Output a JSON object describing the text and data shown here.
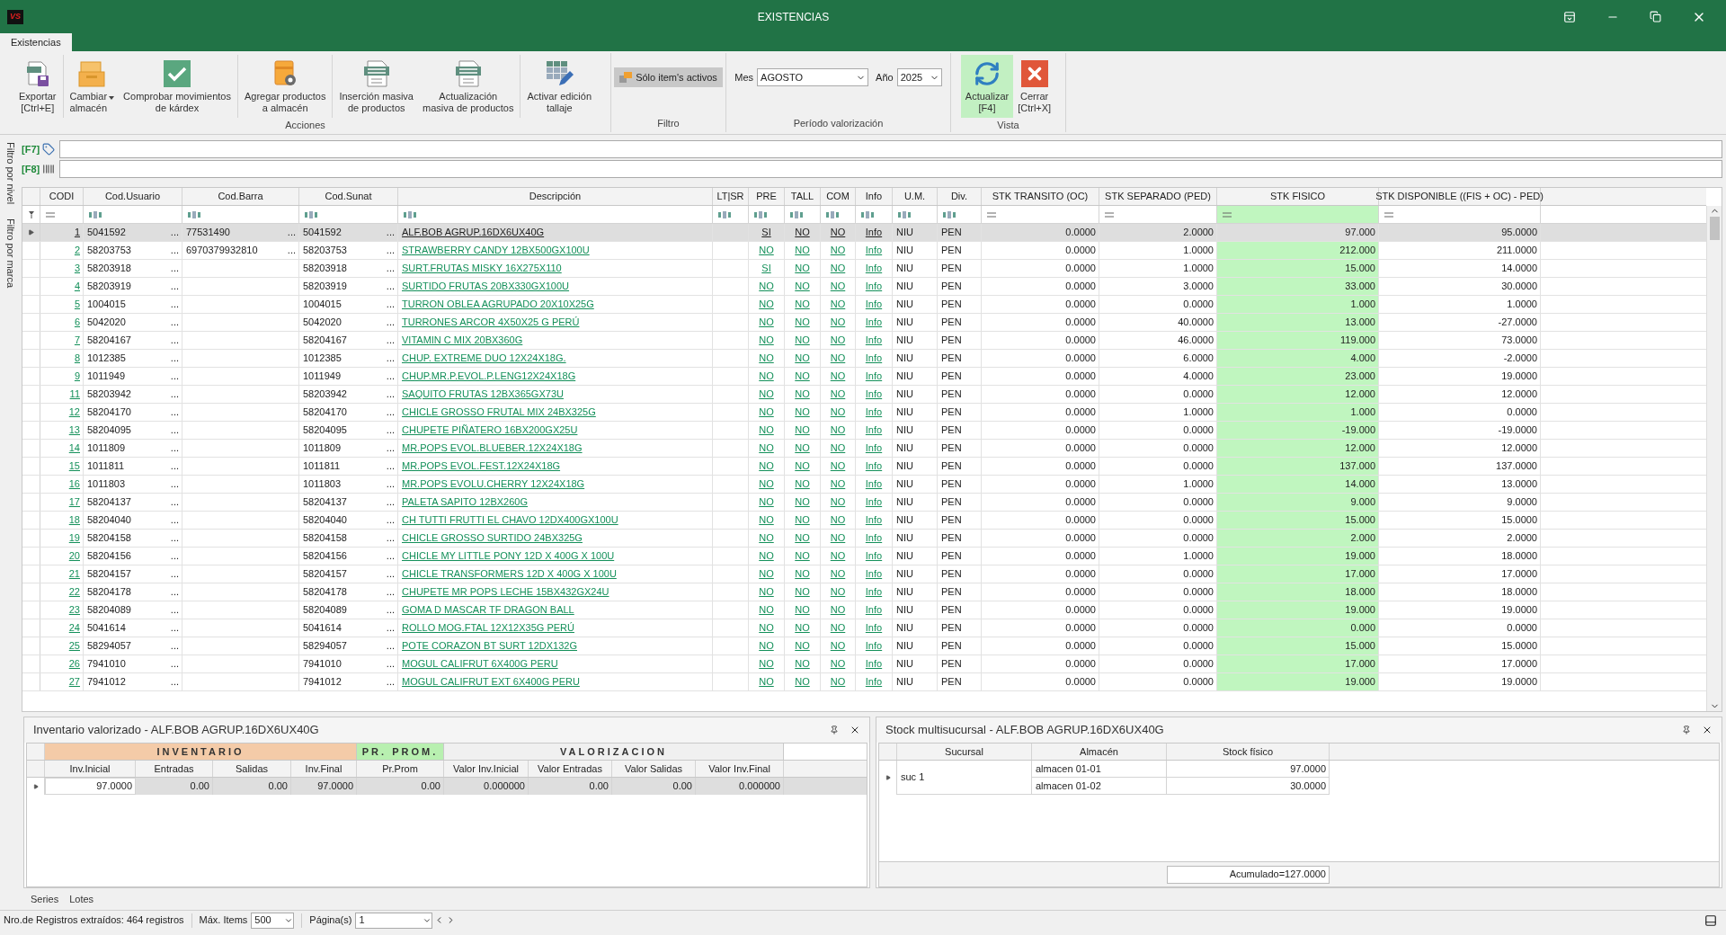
{
  "window": {
    "logo": "VS",
    "title": "EXISTENCIAS"
  },
  "ribbon_tabs": [
    {
      "label": "Existencias",
      "selected": true
    }
  ],
  "ribbon": {
    "acciones": {
      "label": "Acciones",
      "sections": [
        [
          {
            "kind": "export",
            "label": "Exportar\n[Ctrl+E]"
          }
        ],
        [
          {
            "kind": "warehouse",
            "label": "Cambiar\nalmacén",
            "dropdown": true
          },
          {
            "kind": "check",
            "label": "Comprobar movimientos\nde kárdex"
          }
        ],
        [
          {
            "kind": "box-gear",
            "label": "Agregar productos\na almacén"
          }
        ],
        [
          {
            "kind": "sheet",
            "label": "Inserción masiva\nde productos"
          },
          {
            "kind": "sheet",
            "label": "Actualización\nmasiva de productos"
          }
        ],
        [
          {
            "kind": "grid-edit",
            "label": "Activar edición\ntallaje"
          }
        ]
      ]
    },
    "filtro": {
      "label": "Filtro",
      "toggle": {
        "label": "Sólo item's activos",
        "pressed": true
      }
    },
    "periodo": {
      "label": "Período valorización",
      "fields": [
        {
          "label": "Mes",
          "value": "AGOSTO"
        },
        {
          "label": "Año",
          "value": "2025"
        }
      ]
    },
    "vista": {
      "label": "Vista",
      "buttons": [
        {
          "kind": "refresh",
          "label": "Actualizar\n[F4]",
          "highlighted": true
        },
        {
          "kind": "close",
          "label": "Cerrar\n[Ctrl+X]",
          "highlighted": false
        }
      ]
    }
  },
  "side_labels": [
    "Filtro por nivel",
    "Filtro por marca"
  ],
  "filters": [
    {
      "key": "[F7]",
      "kind": "tag"
    },
    {
      "key": "[F8]",
      "kind": "barcode"
    }
  ],
  "grid": {
    "columns": [
      {
        "label": "CODI",
        "kind": "link",
        "highlighted": false
      },
      {
        "label": "Cod.Usuario",
        "kind": "code",
        "highlighted": false
      },
      {
        "label": "Cod.Barra",
        "kind": "code",
        "highlighted": false
      },
      {
        "label": "Cod.Sunat",
        "kind": "code",
        "highlighted": false
      },
      {
        "label": "Descripción",
        "kind": "link",
        "highlighted": false
      },
      {
        "label": "LT|SR",
        "kind": "text",
        "highlighted": false
      },
      {
        "label": "PRE",
        "kind": "link",
        "highlighted": false
      },
      {
        "label": "TALL",
        "kind": "link",
        "highlighted": false
      },
      {
        "label": "COM",
        "kind": "link",
        "highlighted": false
      },
      {
        "label": "Info",
        "kind": "link",
        "highlighted": false
      },
      {
        "label": "U.M.",
        "kind": "text",
        "highlighted": false
      },
      {
        "label": "Div.",
        "kind": "text",
        "highlighted": false
      },
      {
        "label": "STK TRANSITO (OC)",
        "kind": "number",
        "highlighted": false
      },
      {
        "label": "STK SEPARADO (PED)",
        "kind": "number",
        "highlighted": false
      },
      {
        "label": "STK FISICO",
        "kind": "number",
        "highlighted": true
      },
      {
        "label": "STK DISPONIBLE ((FIS + OC) - PED)",
        "kind": "number",
        "highlighted": false
      }
    ],
    "more": "...",
    "rows": [
      {
        "selected": true,
        "codi": "1",
        "usuario": "5041592",
        "barra": "77531490",
        "sunat": "5041592",
        "descripcion": "ALF.BOB AGRUP.16DX6UX40G",
        "pre": "SI",
        "tall": "NO",
        "com": "NO",
        "info": "Info",
        "um": "NIU",
        "div": "PEN",
        "transito": "0.0000",
        "separado": "2.0000",
        "fisico": "97.000",
        "disponible": "95.0000"
      },
      {
        "selected": false,
        "codi": "2",
        "usuario": "58203753",
        "barra": "6970379932810",
        "sunat": "58203753",
        "descripcion": "STRAWBERRY CANDY 12BX500GX100U",
        "pre": "NO",
        "tall": "NO",
        "com": "NO",
        "info": "Info",
        "um": "NIU",
        "div": "PEN",
        "transito": "0.0000",
        "separado": "1.0000",
        "fisico": "212.000",
        "disponible": "211.0000"
      },
      {
        "selected": false,
        "codi": "3",
        "usuario": "58203918",
        "sunat": "58203918",
        "descripcion": "SURT.FRUTAS MISKY 16X275X110",
        "pre": "SI",
        "tall": "NO",
        "com": "NO",
        "info": "Info",
        "um": "NIU",
        "div": "PEN",
        "transito": "0.0000",
        "separado": "1.0000",
        "fisico": "15.000",
        "disponible": "14.0000"
      },
      {
        "selected": false,
        "codi": "4",
        "usuario": "58203919",
        "sunat": "58203919",
        "descripcion": "SURTIDO FRUTAS 20BX330GX100U",
        "pre": "NO",
        "tall": "NO",
        "com": "NO",
        "info": "Info",
        "um": "NIU",
        "div": "PEN",
        "transito": "0.0000",
        "separado": "3.0000",
        "fisico": "33.000",
        "disponible": "30.0000"
      },
      {
        "selected": false,
        "codi": "5",
        "usuario": "1004015",
        "sunat": "1004015",
        "descripcion": "TURRON OBLEA AGRUPADO 20X10X25G",
        "pre": "NO",
        "tall": "NO",
        "com": "NO",
        "info": "Info",
        "um": "NIU",
        "div": "PEN",
        "transito": "0.0000",
        "separado": "0.0000",
        "fisico": "1.000",
        "disponible": "1.0000"
      },
      {
        "selected": false,
        "codi": "6",
        "usuario": "5042020",
        "sunat": "5042020",
        "descripcion": "TURRONES ARCOR 4X50X25 G PERÚ",
        "pre": "NO",
        "tall": "NO",
        "com": "NO",
        "info": "Info",
        "um": "NIU",
        "div": "PEN",
        "transito": "0.0000",
        "separado": "40.0000",
        "fisico": "13.000",
        "disponible": "-27.0000"
      },
      {
        "selected": false,
        "codi": "7",
        "usuario": "58204167",
        "sunat": "58204167",
        "descripcion": "VITAMIN C MIX 20BX360G",
        "pre": "NO",
        "tall": "NO",
        "com": "NO",
        "info": "Info",
        "um": "NIU",
        "div": "PEN",
        "transito": "0.0000",
        "separado": "46.0000",
        "fisico": "119.000",
        "disponible": "73.0000"
      },
      {
        "selected": false,
        "codi": "8",
        "usuario": "1012385",
        "sunat": "1012385",
        "descripcion": "CHUP. EXTREME DUO 12X24X18G.",
        "pre": "NO",
        "tall": "NO",
        "com": "NO",
        "info": "Info",
        "um": "NIU",
        "div": "PEN",
        "transito": "0.0000",
        "separado": "6.0000",
        "fisico": "4.000",
        "disponible": "-2.0000"
      },
      {
        "selected": false,
        "codi": "9",
        "usuario": "1011949",
        "sunat": "1011949",
        "descripcion": "CHUP.MR.P.EVOL.P.LENG12X24X18G",
        "pre": "NO",
        "tall": "NO",
        "com": "NO",
        "info": "Info",
        "um": "NIU",
        "div": "PEN",
        "transito": "0.0000",
        "separado": "4.0000",
        "fisico": "23.000",
        "disponible": "19.0000"
      },
      {
        "selected": false,
        "codi": "11",
        "usuario": "58203942",
        "sunat": "58203942",
        "descripcion": "SAQUITO FRUTAS 12BX365GX73U",
        "pre": "NO",
        "tall": "NO",
        "com": "NO",
        "info": "Info",
        "um": "NIU",
        "div": "PEN",
        "transito": "0.0000",
        "separado": "0.0000",
        "fisico": "12.000",
        "disponible": "12.0000"
      },
      {
        "selected": false,
        "codi": "12",
        "usuario": "58204170",
        "sunat": "58204170",
        "descripcion": "CHICLE GROSSO FRUTAL MIX 24BX325G",
        "pre": "NO",
        "tall": "NO",
        "com": "NO",
        "info": "Info",
        "um": "NIU",
        "div": "PEN",
        "transito": "0.0000",
        "separado": "1.0000",
        "fisico": "1.000",
        "disponible": "0.0000"
      },
      {
        "selected": false,
        "codi": "13",
        "usuario": "58204095",
        "sunat": "58204095",
        "descripcion": "CHUPETE PIÑATERO 16BX200GX25U",
        "pre": "NO",
        "tall": "NO",
        "com": "NO",
        "info": "Info",
        "um": "NIU",
        "div": "PEN",
        "transito": "0.0000",
        "separado": "0.0000",
        "fisico": "-19.000",
        "disponible": "-19.0000"
      },
      {
        "selected": false,
        "codi": "14",
        "usuario": "1011809",
        "sunat": "1011809",
        "descripcion": "MR.POPS EVOL.BLUEBER.12X24X18G",
        "pre": "NO",
        "tall": "NO",
        "com": "NO",
        "info": "Info",
        "um": "NIU",
        "div": "PEN",
        "transito": "0.0000",
        "separado": "0.0000",
        "fisico": "12.000",
        "disponible": "12.0000"
      },
      {
        "selected": false,
        "codi": "15",
        "usuario": "1011811",
        "sunat": "1011811",
        "descripcion": "MR.POPS EVOL.FEST.12X24X18G",
        "pre": "NO",
        "tall": "NO",
        "com": "NO",
        "info": "Info",
        "um": "NIU",
        "div": "PEN",
        "transito": "0.0000",
        "separado": "0.0000",
        "fisico": "137.000",
        "disponible": "137.0000"
      },
      {
        "selected": false,
        "codi": "16",
        "usuario": "1011803",
        "sunat": "1011803",
        "descripcion": "MR.POPS EVOLU.CHERRY 12X24X18G",
        "pre": "NO",
        "tall": "NO",
        "com": "NO",
        "info": "Info",
        "um": "NIU",
        "div": "PEN",
        "transito": "0.0000",
        "separado": "1.0000",
        "fisico": "14.000",
        "disponible": "13.0000"
      },
      {
        "selected": false,
        "codi": "17",
        "usuario": "58204137",
        "sunat": "58204137",
        "descripcion": "PALETA SAPITO 12BX260G",
        "pre": "NO",
        "tall": "NO",
        "com": "NO",
        "info": "Info",
        "um": "NIU",
        "div": "PEN",
        "transito": "0.0000",
        "separado": "0.0000",
        "fisico": "9.000",
        "disponible": "9.0000"
      },
      {
        "selected": false,
        "codi": "18",
        "usuario": "58204040",
        "sunat": "58204040",
        "descripcion": "CH TUTTI FRUTTI EL CHAVO 12DX400GX100U",
        "pre": "NO",
        "tall": "NO",
        "com": "NO",
        "info": "Info",
        "um": "NIU",
        "div": "PEN",
        "transito": "0.0000",
        "separado": "0.0000",
        "fisico": "15.000",
        "disponible": "15.0000"
      },
      {
        "selected": false,
        "codi": "19",
        "usuario": "58204158",
        "sunat": "58204158",
        "descripcion": "CHICLE GROSSO SURTIDO 24BX325G",
        "pre": "NO",
        "tall": "NO",
        "com": "NO",
        "info": "Info",
        "um": "NIU",
        "div": "PEN",
        "transito": "0.0000",
        "separado": "0.0000",
        "fisico": "2.000",
        "disponible": "2.0000"
      },
      {
        "selected": false,
        "codi": "20",
        "usuario": "58204156",
        "sunat": "58204156",
        "descripcion": "CHICLE MY LITTLE PONY 12D X 400G X 100U",
        "pre": "NO",
        "tall": "NO",
        "com": "NO",
        "info": "Info",
        "um": "NIU",
        "div": "PEN",
        "transito": "0.0000",
        "separado": "1.0000",
        "fisico": "19.000",
        "disponible": "18.0000"
      },
      {
        "selected": false,
        "codi": "21",
        "usuario": "58204157",
        "sunat": "58204157",
        "descripcion": "CHICLE TRANSFORMERS 12D X 400G X 100U",
        "pre": "NO",
        "tall": "NO",
        "com": "NO",
        "info": "Info",
        "um": "NIU",
        "div": "PEN",
        "transito": "0.0000",
        "separado": "0.0000",
        "fisico": "17.000",
        "disponible": "17.0000"
      },
      {
        "selected": false,
        "codi": "22",
        "usuario": "58204178",
        "sunat": "58204178",
        "descripcion": "CHUPETE MR POPS LECHE 15BX432GX24U",
        "pre": "NO",
        "tall": "NO",
        "com": "NO",
        "info": "Info",
        "um": "NIU",
        "div": "PEN",
        "transito": "0.0000",
        "separado": "0.0000",
        "fisico": "18.000",
        "disponible": "18.0000"
      },
      {
        "selected": false,
        "codi": "23",
        "usuario": "58204089",
        "sunat": "58204089",
        "descripcion": "GOMA D MASCAR TF DRAGON BALL",
        "pre": "NO",
        "tall": "NO",
        "com": "NO",
        "info": "Info",
        "um": "NIU",
        "div": "PEN",
        "transito": "0.0000",
        "separado": "0.0000",
        "fisico": "19.000",
        "disponible": "19.0000"
      },
      {
        "selected": false,
        "codi": "24",
        "usuario": "5041614",
        "sunat": "5041614",
        "descripcion": "ROLLO MOG.FTAL 12X12X35G PERÚ",
        "pre": "NO",
        "tall": "NO",
        "com": "NO",
        "info": "Info",
        "um": "NIU",
        "div": "PEN",
        "transito": "0.0000",
        "separado": "0.0000",
        "fisico": "0.000",
        "disponible": "0.0000"
      },
      {
        "selected": false,
        "codi": "25",
        "usuario": "58294057",
        "sunat": "58294057",
        "descripcion": "POTE CORAZON BT SURT 12DX132G",
        "pre": "NO",
        "tall": "NO",
        "com": "NO",
        "info": "Info",
        "um": "NIU",
        "div": "PEN",
        "transito": "0.0000",
        "separado": "0.0000",
        "fisico": "15.000",
        "disponible": "15.0000"
      },
      {
        "selected": false,
        "codi": "26",
        "usuario": "7941010",
        "sunat": "7941010",
        "descripcion": "MOGUL CALIFRUT 6X400G PERU",
        "pre": "NO",
        "tall": "NO",
        "com": "NO",
        "info": "Info",
        "um": "NIU",
        "div": "PEN",
        "transito": "0.0000",
        "separado": "0.0000",
        "fisico": "17.000",
        "disponible": "17.0000"
      },
      {
        "selected": false,
        "codi": "27",
        "usuario": "7941012",
        "sunat": "7941012",
        "descripcion": "MOGUL CALIFRUT EXT 6X400G PERU",
        "pre": "NO",
        "tall": "NO",
        "com": "NO",
        "info": "Info",
        "um": "NIU",
        "div": "PEN",
        "transito": "0.0000",
        "separado": "0.0000",
        "fisico": "19.000",
        "disponible": "19.0000"
      }
    ]
  },
  "inventory_panel": {
    "title": "Inventario valorizado - ALF.BOB AGRUP.16DX6UX40G",
    "bands": [
      {
        "label": "INVENTARIO",
        "color": "#f4cba8",
        "columns": [
          "Inv.Inicial",
          "Entradas",
          "Salidas",
          "Inv.Final"
        ]
      },
      {
        "label": "PR. PROM.",
        "color": "#b8f0b0",
        "columns": [
          "Pr.Prom"
        ]
      },
      {
        "label": "VALORIZACION",
        "color": "#f0f0f0",
        "columns": [
          "Valor Inv.Inicial",
          "Valor Entradas",
          "Valor Salidas",
          "Valor Inv.Final"
        ]
      }
    ],
    "rows": [
      {
        "selected": true,
        "values": [
          {
            "text": "97.0000",
            "focused": true
          },
          {
            "text": "0.00",
            "focused": false
          },
          {
            "text": "0.00",
            "focused": false
          },
          {
            "text": "97.0000",
            "focused": false
          },
          {
            "text": "0.00",
            "focused": false
          },
          {
            "text": "0.000000",
            "focused": false
          },
          {
            "text": "0.00",
            "focused": false
          },
          {
            "text": "0.00",
            "focused": false
          },
          {
            "text": "0.000000",
            "focused": false
          }
        ]
      }
    ]
  },
  "stock_panel": {
    "title": "Stock multisucursal - ALF.BOB AGRUP.16DX6UX40G",
    "columns": [
      "Sucursal",
      "Almacén",
      "Stock físico"
    ],
    "groups": [
      {
        "sucursal": "suc 1",
        "selected": true,
        "rows": [
          {
            "almacen": "almacen 01-01",
            "stock": "97.0000"
          },
          {
            "almacen": "almacen 01-02",
            "stock": "30.0000"
          }
        ]
      }
    ],
    "footer": "Acumulado=127.0000"
  },
  "bottom_tabs": [
    {
      "label": "Series"
    },
    {
      "label": "Lotes"
    }
  ],
  "status_bar": {
    "records": "Nro.de Registros extraídos: 464 registros",
    "max_label": "Máx. Items",
    "max_value": "500",
    "page_label": "Página(s)",
    "page_value": "1"
  }
}
